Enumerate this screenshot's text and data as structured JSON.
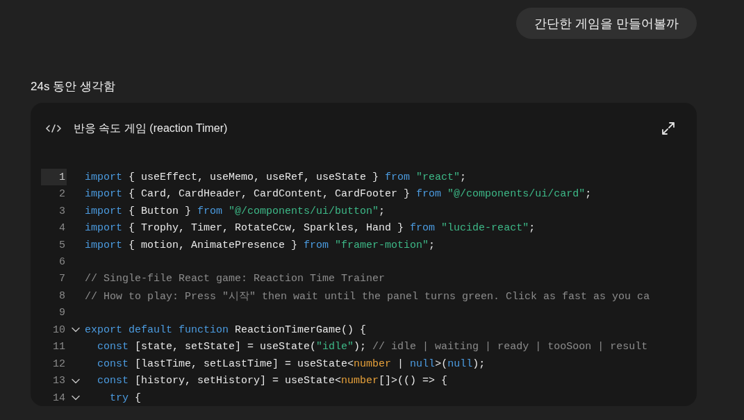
{
  "user_message": {
    "text": "간단한 게임을 만들어볼까"
  },
  "thinking": {
    "label": "24s 동안 생각함"
  },
  "code_card": {
    "title": "반응 속도 게임 (reaction Timer)",
    "lines": [
      {
        "number": "1",
        "selected": true,
        "foldable": false,
        "tokens": [
          {
            "kind": "keyword",
            "text": "import"
          },
          {
            "kind": "plain",
            "text": " { useEffect, useMemo, useRef, useState } "
          },
          {
            "kind": "keyword",
            "text": "from"
          },
          {
            "kind": "string",
            "text": " \"react\""
          },
          {
            "kind": "plain",
            "text": ";"
          }
        ]
      },
      {
        "number": "2",
        "selected": false,
        "foldable": false,
        "tokens": [
          {
            "kind": "keyword",
            "text": "import"
          },
          {
            "kind": "plain",
            "text": " { Card, CardHeader, CardContent, CardFooter } "
          },
          {
            "kind": "keyword",
            "text": "from"
          },
          {
            "kind": "string",
            "text": " \"@/components/ui/card\""
          },
          {
            "kind": "plain",
            "text": ";"
          }
        ]
      },
      {
        "number": "3",
        "selected": false,
        "foldable": false,
        "tokens": [
          {
            "kind": "keyword",
            "text": "import"
          },
          {
            "kind": "plain",
            "text": " { Button } "
          },
          {
            "kind": "keyword",
            "text": "from"
          },
          {
            "kind": "string",
            "text": " \"@/components/ui/button\""
          },
          {
            "kind": "plain",
            "text": ";"
          }
        ]
      },
      {
        "number": "4",
        "selected": false,
        "foldable": false,
        "tokens": [
          {
            "kind": "keyword",
            "text": "import"
          },
          {
            "kind": "plain",
            "text": " { Trophy, Timer, RotateCcw, Sparkles, Hand } "
          },
          {
            "kind": "keyword",
            "text": "from"
          },
          {
            "kind": "string",
            "text": " \"lucide-react\""
          },
          {
            "kind": "plain",
            "text": ";"
          }
        ]
      },
      {
        "number": "5",
        "selected": false,
        "foldable": false,
        "tokens": [
          {
            "kind": "keyword",
            "text": "import"
          },
          {
            "kind": "plain",
            "text": " { motion, AnimatePresence } "
          },
          {
            "kind": "keyword",
            "text": "from"
          },
          {
            "kind": "string",
            "text": " \"framer-motion\""
          },
          {
            "kind": "plain",
            "text": ";"
          }
        ]
      },
      {
        "number": "6",
        "selected": false,
        "foldable": false
      },
      {
        "number": "7",
        "selected": false,
        "foldable": false,
        "tokens": [
          {
            "kind": "comment",
            "text": "// Single-file React game: Reaction Time Trainer"
          }
        ]
      },
      {
        "number": "8",
        "selected": false,
        "foldable": false,
        "tokens": [
          {
            "kind": "comment",
            "text": "// How to play: Press \"시작\" then wait until the panel turns green. Click as fast as you ca"
          }
        ]
      },
      {
        "number": "9",
        "selected": false,
        "foldable": false
      },
      {
        "number": "10",
        "selected": false,
        "foldable": true,
        "tokens": [
          {
            "kind": "keyword",
            "text": "export default function"
          },
          {
            "kind": "plain",
            "text": " ReactionTimerGame() {"
          }
        ]
      },
      {
        "number": "11",
        "selected": false,
        "foldable": false,
        "tokens": [
          {
            "kind": "keyword",
            "text": "  const"
          },
          {
            "kind": "plain",
            "text": " [state, setState] = useState("
          },
          {
            "kind": "string",
            "text": "\"idle\""
          },
          {
            "kind": "plain",
            "text": ");"
          },
          {
            "kind": "comment",
            "text": " // idle | waiting | ready | tooSoon | result"
          }
        ]
      },
      {
        "number": "12",
        "selected": false,
        "foldable": false,
        "tokens": [
          {
            "kind": "keyword",
            "text": "  const"
          },
          {
            "kind": "plain",
            "text": " [lastTime, setLastTime] = useState<"
          },
          {
            "kind": "type",
            "text": "number"
          },
          {
            "kind": "plain",
            "text": " | "
          },
          {
            "kind": "keyword",
            "text": "null"
          },
          {
            "kind": "plain",
            "text": ">("
          },
          {
            "kind": "keyword",
            "text": "null"
          },
          {
            "kind": "plain",
            "text": ");"
          }
        ]
      },
      {
        "number": "13",
        "selected": false,
        "foldable": true,
        "tokens": [
          {
            "kind": "keyword",
            "text": "  const"
          },
          {
            "kind": "plain",
            "text": " [history, setHistory] = useState<"
          },
          {
            "kind": "type",
            "text": "number"
          },
          {
            "kind": "plain",
            "text": "[]>(() => {"
          }
        ]
      },
      {
        "number": "14",
        "selected": false,
        "foldable": true,
        "tokens": [
          {
            "kind": "keyword",
            "text": "    try"
          },
          {
            "kind": "plain",
            "text": " {"
          }
        ]
      }
    ]
  }
}
